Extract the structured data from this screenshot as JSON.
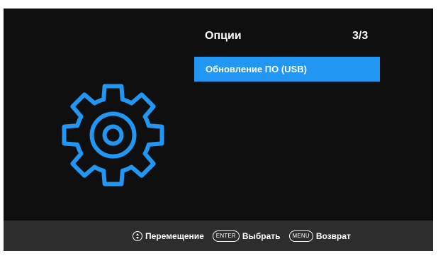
{
  "menu": {
    "title": "Опции",
    "page_counter": "3/3",
    "items": [
      {
        "label": "Обновление ПО (USB)",
        "selected": true
      }
    ]
  },
  "panel_icon": "gear-icon",
  "footer": {
    "navigate_icon": "navigate-updown-icon",
    "navigate_label": "Перемещение",
    "enter_key": "ENTER",
    "enter_label": "Выбрать",
    "menu_key": "MENU",
    "menu_label": "Возврат"
  },
  "colors": {
    "background": "#0f0f0f",
    "accent": "#2196f3",
    "footer_bg": "#2d2d2d",
    "text": "#ffffff"
  }
}
